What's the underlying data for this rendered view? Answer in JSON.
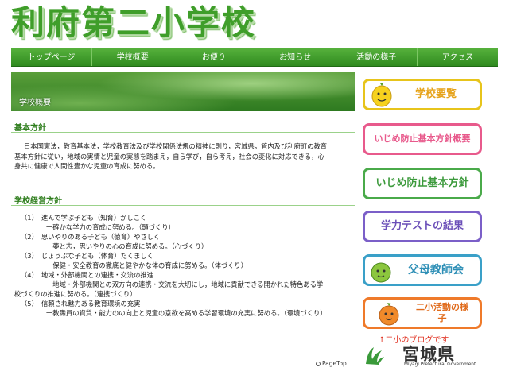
{
  "site": {
    "title": "利府第二小学校"
  },
  "nav": {
    "items": [
      {
        "label": "トップページ"
      },
      {
        "label": "学校概要"
      },
      {
        "label": "お便り"
      },
      {
        "label": "お知らせ"
      },
      {
        "label": "活動の様子"
      },
      {
        "label": "アクセス"
      }
    ]
  },
  "banner": {
    "title": "学校概要"
  },
  "basic_policy": {
    "heading": "基本方針",
    "lines": [
      "日本国憲法，教育基本法，学校教育法及び学校関係法規の精神に則り，宮城県，管内及び利府町の教育",
      "基本方針に従い，地域の実情と児童の実態を踏まえ，自ら学び，自ら考え，社会の変化に対応できる，心",
      "身共に健康で人間性豊かな児童の育成に努める。"
    ]
  },
  "management_policy": {
    "heading": "学校経営方針",
    "items": [
      {
        "num": "（1）",
        "title": "進んで学ぶ子ども（知育）かしこく",
        "detail": "一確かな学力の育成に努める。（頭づくり）"
      },
      {
        "num": "（2）",
        "title": "思いやりのある子ども（徳育）やさしく",
        "detail": "一夢と志，思いやりの心の育成に努める。（心づくり）"
      },
      {
        "num": "（3）",
        "title": "じょうぶな子ども（体育）たくましく",
        "detail": "一保健・安全教育の徹底と健やかな体の育成に努める。（体づくり）"
      },
      {
        "num": "（4）",
        "title": "地域・外部機関との連携・交流の推進",
        "detail": "一地域・外部機関との双方向の連携・交流を大切にし，地域に貢献できる開かれた特色ある学",
        "detail2": "校づくりの推進に努める。（連携づくり）"
      },
      {
        "num": "（5）",
        "title": "信頼され魅力ある教育環境の充実",
        "detail": "一教職員の資質・能力のの向上と児童の意欲を高める学習環境の充実に努める。（環境づくり）"
      }
    ]
  },
  "pagetop": {
    "label": "PageTop"
  },
  "sidebar": {
    "buttons": [
      {
        "label": "学校要覧",
        "accent": "#e7c41b"
      },
      {
        "label": "いじめ防止基本方針概要",
        "accent": "#e85a8c"
      },
      {
        "label": "いじめ防止基本方針",
        "accent": "#4aaa4a"
      },
      {
        "label": "学力テストの結果",
        "accent": "#7b5fc8"
      },
      {
        "label": "父母教師会",
        "accent": "#3aa0c8"
      },
      {
        "label": "二小活動の様子",
        "accent": "#ef7a2a"
      }
    ],
    "blog_link": "↑二小のブログです",
    "pref_name": "宮城県",
    "pref_name_en": "Miyagi Prefectural Government"
  }
}
